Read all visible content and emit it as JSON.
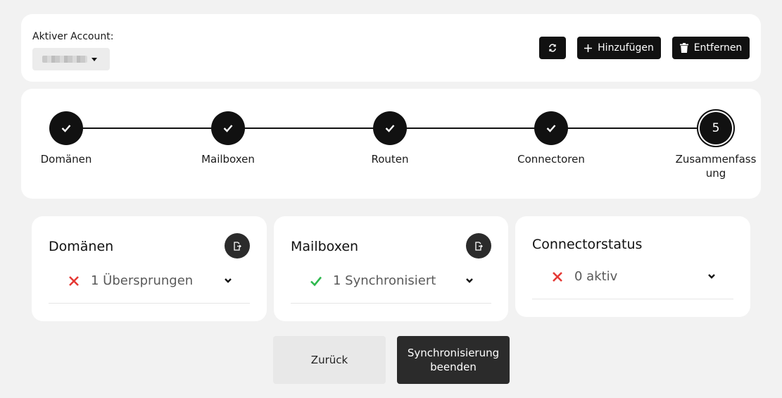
{
  "account": {
    "label": "Aktiver Account:",
    "selected_value": ""
  },
  "toolbar": {
    "refresh_icon": "refresh-icon",
    "add_label": "Hinzufügen",
    "remove_label": "Entfernen"
  },
  "stepper": {
    "steps": [
      {
        "label": "Domänen",
        "state": "done"
      },
      {
        "label": "Mailboxen",
        "state": "done"
      },
      {
        "label": "Routen",
        "state": "done"
      },
      {
        "label": "Connectoren",
        "state": "done"
      },
      {
        "label": "Zusammenfassung",
        "state": "current",
        "number": "5"
      }
    ]
  },
  "summary": {
    "domains": {
      "title": "Domänen",
      "status": "1 Übersprungen",
      "status_type": "error"
    },
    "mailboxes": {
      "title": "Mailboxen",
      "status": "1 Synchronisiert",
      "status_type": "success"
    },
    "connectors": {
      "title": "Connectorstatus",
      "status": "0 aktiv",
      "status_type": "error"
    }
  },
  "footer": {
    "back_label": "Zurück",
    "finish_label": "Synchronisierung beenden"
  },
  "colors": {
    "error": "#e53935",
    "success": "#2db84d",
    "primary": "#111111"
  }
}
